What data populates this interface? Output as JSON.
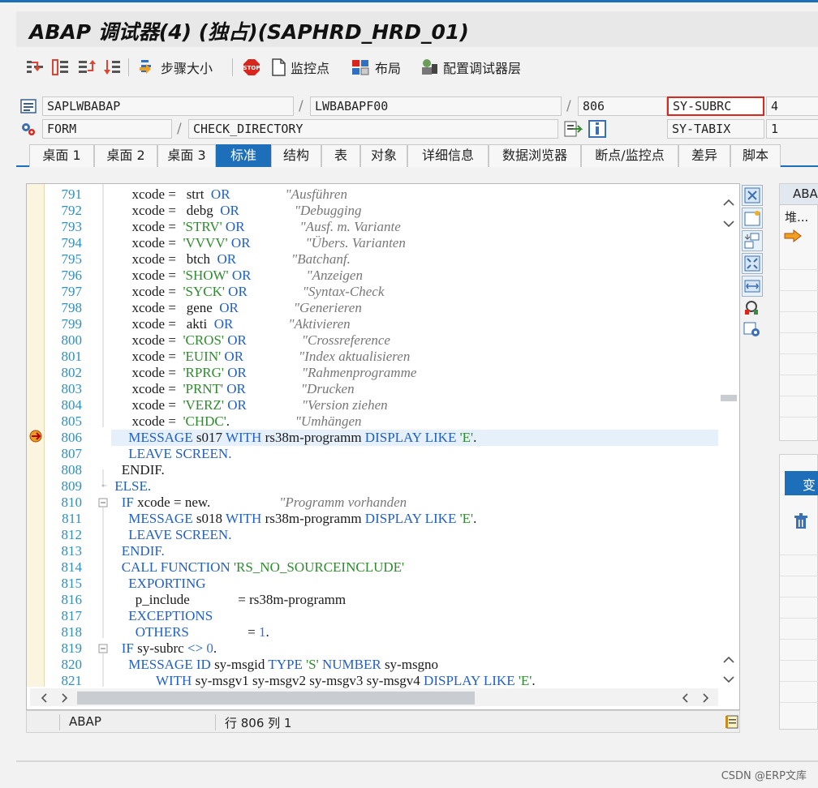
{
  "window": {
    "title": "ABAP 调试器(4) (独占)(SAPHRD_HRD_01)"
  },
  "toolbar": {
    "step_size": "步骤大小",
    "watchpoint": "监控点",
    "layout": "布局",
    "config_layers": "配置调试器层"
  },
  "context": {
    "program": "SAPLWBABAP",
    "include": "LWBABAPF00",
    "line_no": "806",
    "var1_name": "SY-SUBRC",
    "var1_value": "4",
    "block_type": "FORM",
    "block_name": "CHECK_DIRECTORY",
    "var2_name": "SY-TABIX",
    "var2_value": "1"
  },
  "tabs": [
    "桌面 1",
    "桌面 2",
    "桌面 3",
    "标准",
    "结构",
    "表",
    "对象",
    "详细信息",
    "数据浏览器",
    "断点/监控点",
    "差异",
    "脚本"
  ],
  "code": {
    "lines": [
      {
        "n": "791"
      },
      {
        "n": "792"
      },
      {
        "n": "793"
      },
      {
        "n": "794"
      },
      {
        "n": "795"
      },
      {
        "n": "796"
      },
      {
        "n": "797"
      },
      {
        "n": "798"
      },
      {
        "n": "799"
      },
      {
        "n": "800"
      },
      {
        "n": "801"
      },
      {
        "n": "802"
      },
      {
        "n": "803"
      },
      {
        "n": "804"
      },
      {
        "n": "805"
      },
      {
        "n": "806"
      },
      {
        "n": "807"
      },
      {
        "n": "808"
      },
      {
        "n": "809"
      },
      {
        "n": "810"
      },
      {
        "n": "811"
      },
      {
        "n": "812"
      },
      {
        "n": "813"
      },
      {
        "n": "814"
      },
      {
        "n": "815"
      },
      {
        "n": "816"
      },
      {
        "n": "817"
      },
      {
        "n": "818"
      },
      {
        "n": "819"
      },
      {
        "n": "820"
      },
      {
        "n": "821"
      }
    ],
    "tokens": {
      "xcode": "xcode",
      "eq": "=",
      "or": "OR",
      "strt": "strt",
      "debg": "debg",
      "gene": "gene",
      "akti": "akti",
      "btch": "btch",
      "s_strv": "'STRV'",
      "s_vvvv": "'VVVV'",
      "s_show": "'SHOW'",
      "s_syck": "'SYCK'",
      "s_cros": "'CROS'",
      "s_euin": "'EUIN'",
      "s_rprg": "'RPRG'",
      "s_prnt": "'PRNT'",
      "s_verz": "'VERZ'",
      "s_chdc": "'CHDC'",
      "c_ausf": "\"Ausführen",
      "c_debg": "\"Debugging",
      "c_ausfv": "\"Ausf. m. Variante",
      "c_ubers": "\"Übers. Varianten",
      "c_batch": "\"Batchanf.",
      "c_anz": "\"Anzeigen",
      "c_syn": "\"Syntax-Check",
      "c_gen": "\"Generieren",
      "c_akt": "\"Aktivieren",
      "c_cross": "\"Crossreference",
      "c_index": "\"Index aktualisieren",
      "c_rahmen": "\"Rahmenprogramme",
      "c_druck": "\"Drucken",
      "c_vers": "\"Version ziehen",
      "c_umh": "\"Umhängen",
      "c_prog": "\"Programm vorhanden",
      "message": "MESSAGE",
      "s017": "s017",
      "s018": "s018",
      "with": "WITH",
      "prog": "rs38m-programm",
      "display_like": "DISPLAY LIKE",
      "s_e": "'E'",
      "leave": "LEAVE SCREEN.",
      "endif": "ENDIF.",
      "else": "ELSE.",
      "if": "IF",
      "new": "new.",
      "call_function": "CALL FUNCTION",
      "fm": "'RS_NO_SOURCEINCLUDE'",
      "exporting": "EXPORTING",
      "p_include": "p_include",
      "exceptions": "EXCEPTIONS",
      "others": "OTHERS",
      "one": "1",
      "subrc": "sy-subrc",
      "ne": "<>",
      "zero": "0",
      "id": "ID",
      "msgid": "sy-msgid",
      "type": "TYPE",
      "s_s": "'S'",
      "number": "NUMBER",
      "msgno": "sy-msgno",
      "msgv": "sy-msgv1 sy-msgv2 sy-msgv3 sy-msgv4"
    }
  },
  "status": {
    "language": "ABAP",
    "position": "行 806 列   1"
  },
  "right": {
    "header": "ABA",
    "stack_label": "堆...",
    "tab_label": "变"
  },
  "watermark": "CSDN @ERP文库"
}
